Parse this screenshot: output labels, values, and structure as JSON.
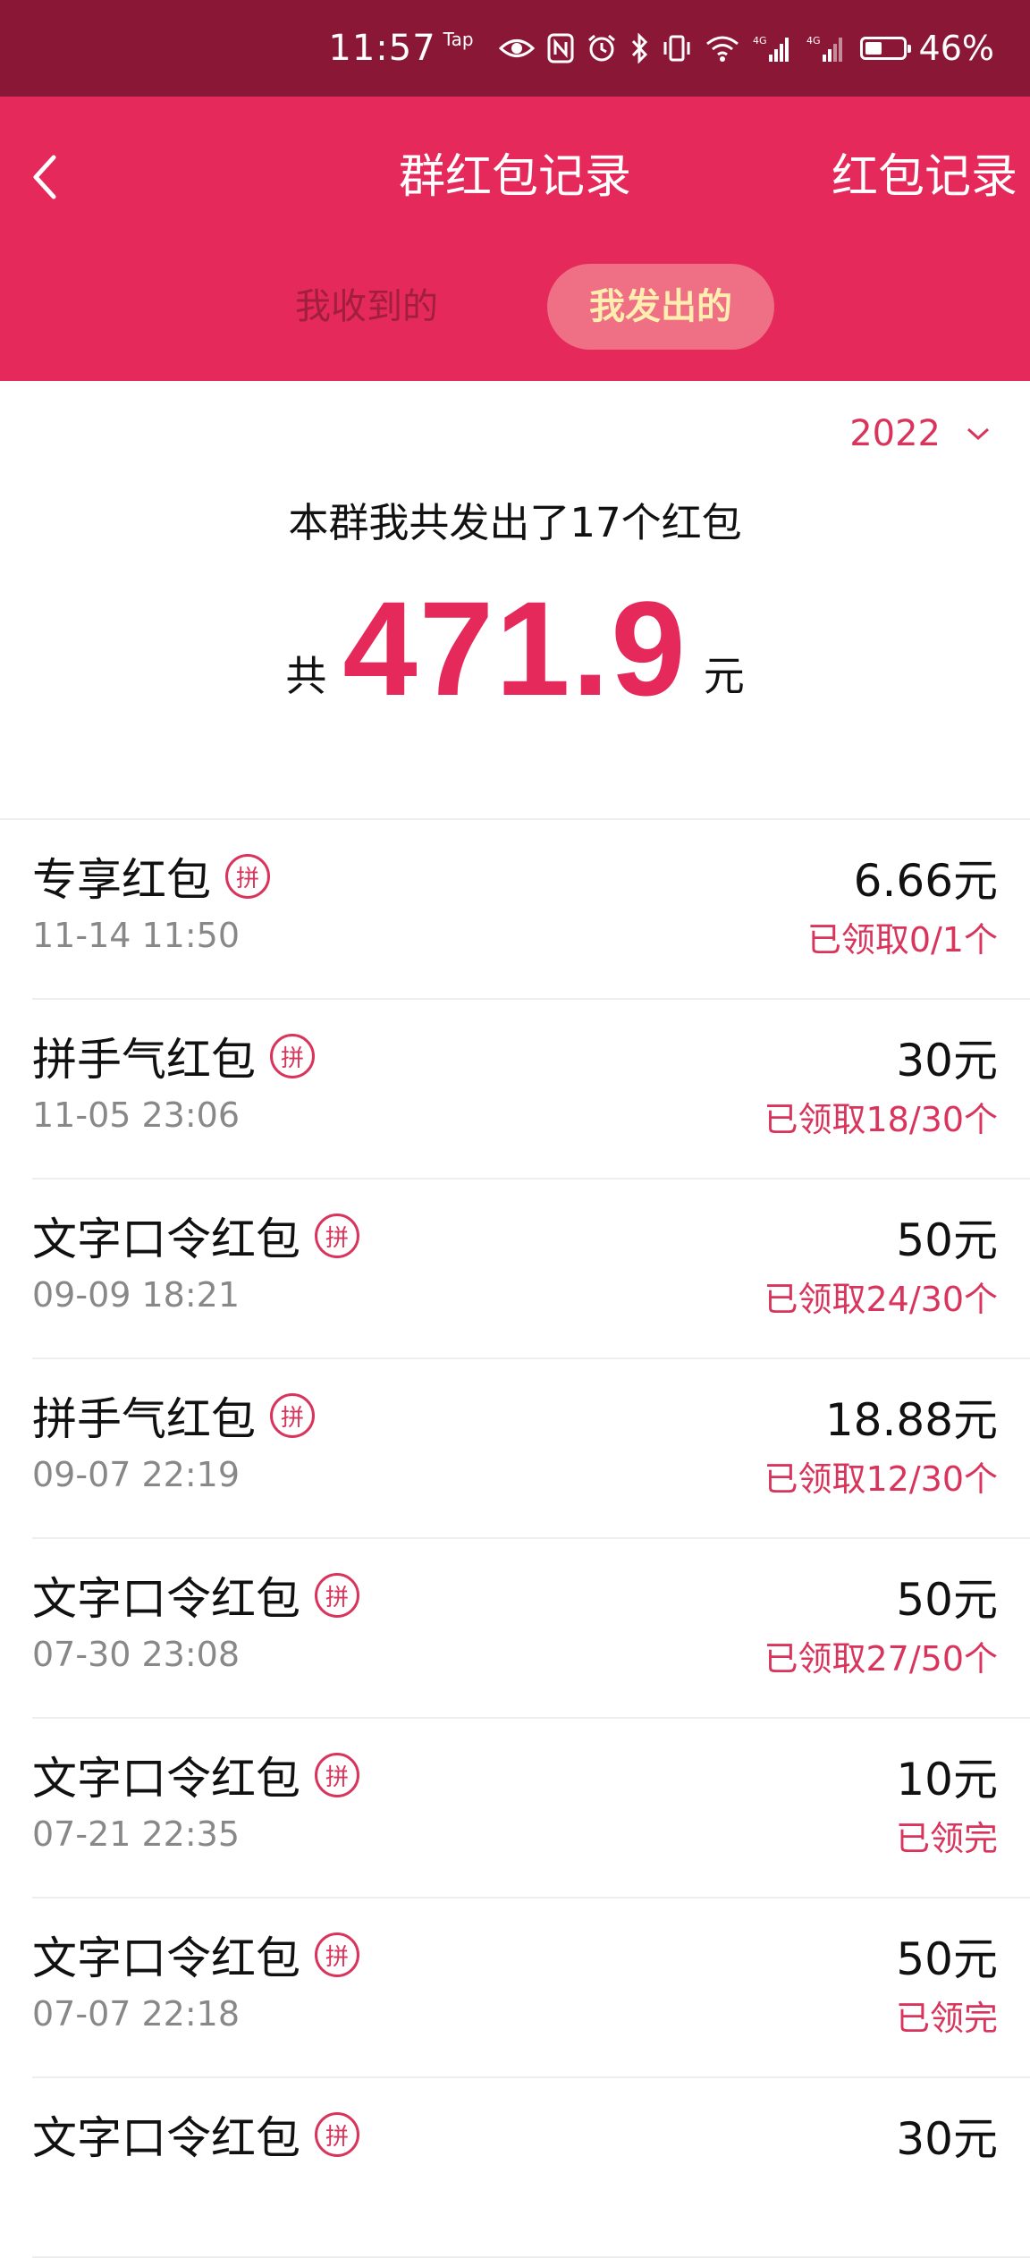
{
  "status_bar": {
    "time": "11:57",
    "tap_label": "Tap",
    "battery_percent": "46%",
    "battery_level": 0.46,
    "icons": [
      "eye-icon",
      "nfc-icon",
      "alarm-icon",
      "bluetooth-icon",
      "vibrate-icon",
      "wifi-icon",
      "signal-4g-icon",
      "signal-4g-icon",
      "battery-icon"
    ]
  },
  "header": {
    "title": "群红包记录",
    "record_link": "红包记录",
    "back_icon": "chevron-left-icon"
  },
  "tabs": [
    {
      "label": "我收到的",
      "active": false
    },
    {
      "label": "我发出的",
      "active": true
    }
  ],
  "summary": {
    "year": "2022",
    "description": "本群我共发出了17个红包",
    "total_prefix": "共",
    "total_amount": "471.9",
    "total_suffix": "元"
  },
  "colors": {
    "header_red": "#e5295a",
    "status_bar": "#8b1736",
    "accent": "#d9345c",
    "active_tab_text": "#ffeeb0"
  },
  "records": [
    {
      "name": "专享红包",
      "badge": "拼",
      "time": "11-14 11:50",
      "amount": "6.66元",
      "status": "已领取0/1个"
    },
    {
      "name": "拼手气红包",
      "badge": "拼",
      "time": "11-05 23:06",
      "amount": "30元",
      "status": "已领取18/30个"
    },
    {
      "name": "文字口令红包",
      "badge": "拼",
      "time": "09-09 18:21",
      "amount": "50元",
      "status": "已领取24/30个"
    },
    {
      "name": "拼手气红包",
      "badge": "拼",
      "time": "09-07 22:19",
      "amount": "18.88元",
      "status": "已领取12/30个"
    },
    {
      "name": "文字口令红包",
      "badge": "拼",
      "time": "07-30 23:08",
      "amount": "50元",
      "status": "已领取27/50个"
    },
    {
      "name": "文字口令红包",
      "badge": "拼",
      "time": "07-21 22:35",
      "amount": "10元",
      "status": "已领完"
    },
    {
      "name": "文字口令红包",
      "badge": "拼",
      "time": "07-07 22:18",
      "amount": "50元",
      "status": "已领完"
    },
    {
      "name": "文字口令红包",
      "badge": "拼",
      "time": "",
      "amount": "30元",
      "status": ""
    }
  ]
}
